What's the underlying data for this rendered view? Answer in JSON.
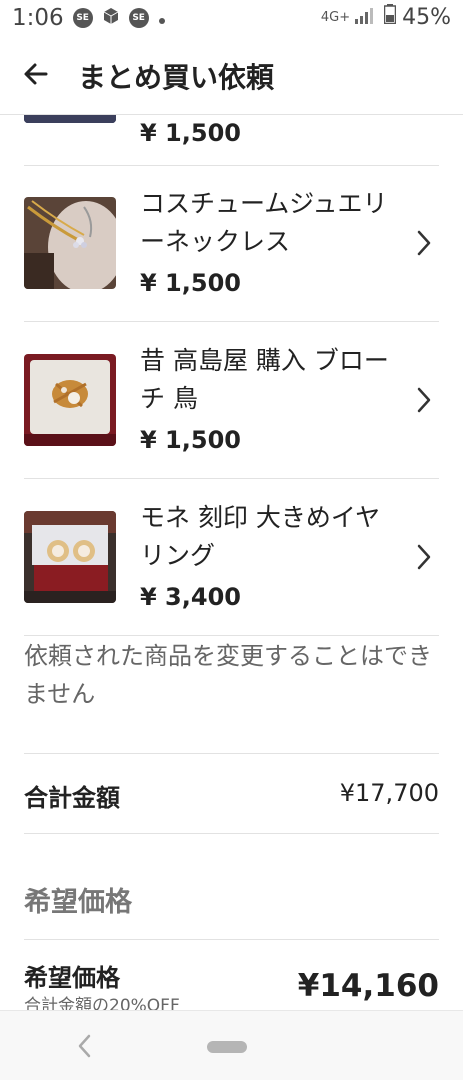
{
  "status_bar": {
    "time": "1:06",
    "icons": [
      "se-badge-icon",
      "cube-icon",
      "se-badge-icon",
      "dot-icon"
    ],
    "badge_text": "SE",
    "network": "4G+",
    "battery": "45%"
  },
  "app_bar": {
    "back_icon": "arrow-left-icon",
    "title": "まとめ買い依頼"
  },
  "items": [
    {
      "name": "",
      "price": "¥ 1,500"
    },
    {
      "name": "コスチュームジュエリーネックレス",
      "price": "¥ 1,500"
    },
    {
      "name": "昔 高島屋 購入 ブローチ 鳥",
      "price": "¥ 1,500"
    },
    {
      "name": "モネ 刻印 大きめイヤリング",
      "price": "¥ 3,400"
    }
  ],
  "note": "依頼された商品を変更することはできません",
  "total": {
    "label": "合計金額",
    "value": "¥17,700"
  },
  "desired_section": {
    "title": "希望価格",
    "label": "希望価格",
    "sub": "合計金額の20%OFF",
    "value": "¥14,160"
  },
  "colors": {
    "text": "#222222",
    "muted": "#666666",
    "divider": "#e2e2e2"
  }
}
